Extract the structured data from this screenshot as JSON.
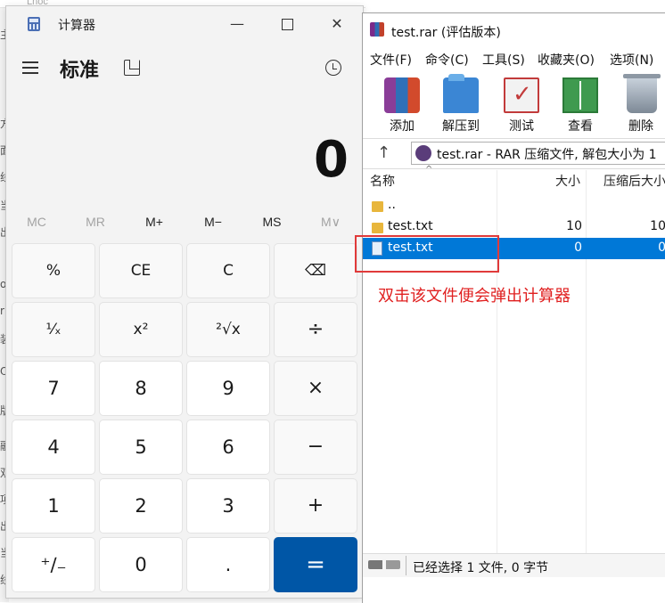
{
  "background": {
    "top_text": "Lnoc",
    "left_glyphs": [
      "主",
      "方",
      "面",
      "线",
      "当",
      "出",
      "or",
      "r",
      "装",
      "O",
      "版",
      "融",
      "双",
      "项",
      "出",
      "当",
      "线"
    ]
  },
  "calculator": {
    "title": "计算器",
    "mode": "标准",
    "display": "0",
    "memory": [
      "MC",
      "MR",
      "M+",
      "M−",
      "MS",
      "M∨"
    ],
    "keys": {
      "percent": "%",
      "ce": "CE",
      "clear": "C",
      "backspace": "⌫",
      "reciprocal": "¹⁄ₓ",
      "square": "x²",
      "sqrt": "²√x",
      "divide": "÷",
      "seven": "7",
      "eight": "8",
      "nine": "9",
      "multiply": "×",
      "four": "4",
      "five": "5",
      "six": "6",
      "minus": "−",
      "one": "1",
      "two": "2",
      "three": "3",
      "plus": "+",
      "negate": "⁺∕₋",
      "zero": "0",
      "decimal": ".",
      "equals": "="
    }
  },
  "winrar": {
    "title": "test.rar (评估版本)",
    "menu": [
      "文件(F)",
      "命令(C)",
      "工具(S)",
      "收藏夹(O)",
      "选项(N)"
    ],
    "toolbar": [
      "添加",
      "解压到",
      "测试",
      "查看",
      "删除"
    ],
    "address": "test.rar - RAR 压缩文件, 解包大小为 1",
    "columns": {
      "name": "名称",
      "size": "大小",
      "packed": "压缩后大小"
    },
    "rows": [
      {
        "name": "..",
        "size": "",
        "packed": ""
      },
      {
        "name": "test.txt",
        "size": "10",
        "packed": "10"
      },
      {
        "name": "test.txt",
        "size": "0",
        "packed": "0"
      }
    ],
    "status": "已经选择 1 文件, 0 字节"
  },
  "annotation": "双击该文件便会弹出计算器",
  "colors": {
    "accent": "#0056a6",
    "selection": "#0078d7",
    "annotation": "#e02020"
  }
}
